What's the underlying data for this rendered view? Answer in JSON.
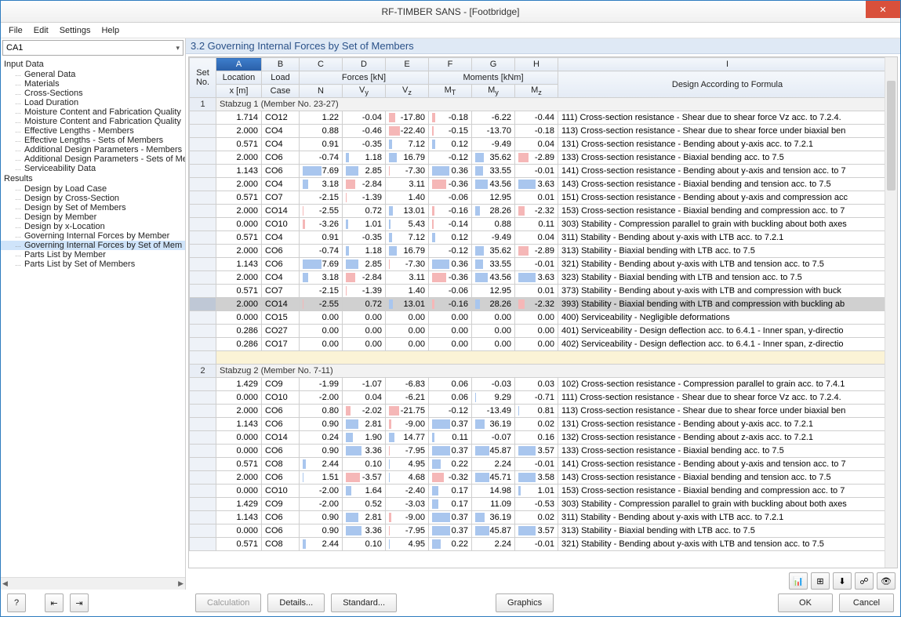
{
  "window": {
    "title": "RF-TIMBER SANS - [Footbridge]"
  },
  "menu": {
    "file": "File",
    "edit": "Edit",
    "settings": "Settings",
    "help": "Help"
  },
  "combo": {
    "value": "CA1"
  },
  "tree": {
    "input_label": "Input Data",
    "input": [
      "General Data",
      "Materials",
      "Cross-Sections",
      "Load Duration",
      "Moisture Content and Fabrication Quality",
      "Moisture Content and Fabrication Quality",
      "Effective Lengths - Members",
      "Effective Lengths - Sets of Members",
      "Additional Design Parameters - Members",
      "Additional Design Parameters - Sets of Me",
      "Serviceability Data"
    ],
    "results_label": "Results",
    "results": [
      "Design by Load Case",
      "Design by Cross-Section",
      "Design by Set of Members",
      "Design by Member",
      "Design by x-Location",
      "Governing Internal Forces by Member",
      "Governing Internal Forces by Set of Mem",
      "Parts List by Member",
      "Parts List by Set of Members"
    ],
    "selected_result_index": 6
  },
  "heading": "3.2  Governing Internal Forces by Set of Members",
  "columns": {
    "letters": [
      "A",
      "B",
      "C",
      "D",
      "E",
      "F",
      "G",
      "H",
      "I"
    ],
    "set": "Set\nNo.",
    "loc": "Location\nx [m]",
    "lc": "Load\nCase",
    "forces": "Forces [kN]",
    "moments": "Moments [kNm]",
    "n": "N",
    "vy": "Vy",
    "vz": "Vz",
    "mt": "MT",
    "my": "My",
    "mz": "Mz",
    "desc": "Design According to Formula"
  },
  "groups": [
    {
      "no": "1",
      "title": "Stabzug 1 (Member No. 23-27)",
      "rows": [
        {
          "x": "1.714",
          "lc": "CO12",
          "N": "1.22",
          "Vy": "-0.04",
          "Vz": "-17.80",
          "MT": "-0.18",
          "My": "-6.22",
          "Mz": "-0.44",
          "d": "111) Cross-section resistance - Shear due to shear force Vz acc. to 7.2.4."
        },
        {
          "x": "2.000",
          "lc": "CO4",
          "N": "0.88",
          "Vy": "-0.46",
          "Vz": "-22.40",
          "MT": "-0.15",
          "My": "-13.70",
          "Mz": "-0.18",
          "d": "113) Cross-section resistance - Shear due to shear force under biaxial ben"
        },
        {
          "x": "0.571",
          "lc": "CO4",
          "N": "0.91",
          "Vy": "-0.35",
          "Vz": "7.12",
          "MT": "0.12",
          "My": "-9.49",
          "Mz": "0.04",
          "d": "131) Cross-section resistance - Bending about y-axis acc. to 7.2.1"
        },
        {
          "x": "2.000",
          "lc": "CO6",
          "N": "-0.74",
          "Vy": "1.18",
          "Vz": "16.79",
          "MT": "-0.12",
          "My": "35.62",
          "Mz": "-2.89",
          "d": "133) Cross-section resistance - Biaxial bending acc. to 7.5"
        },
        {
          "x": "1.143",
          "lc": "CO6",
          "N": "7.69",
          "Vy": "2.85",
          "Vz": "-7.30",
          "MT": "0.36",
          "My": "33.55",
          "Mz": "-0.01",
          "d": "141) Cross-section resistance - Bending about y-axis and tension acc. to 7"
        },
        {
          "x": "2.000",
          "lc": "CO4",
          "N": "3.18",
          "Vy": "-2.84",
          "Vz": "3.11",
          "MT": "-0.36",
          "My": "43.56",
          "Mz": "3.63",
          "d": "143) Cross-section resistance - Biaxial bending and tension acc. to 7.5"
        },
        {
          "x": "0.571",
          "lc": "CO7",
          "N": "-2.15",
          "Vy": "-1.39",
          "Vz": "1.40",
          "MT": "-0.06",
          "My": "12.95",
          "Mz": "0.01",
          "d": "151) Cross-section resistance - Bending about y-axis and compression acc"
        },
        {
          "x": "2.000",
          "lc": "CO14",
          "N": "-2.55",
          "Vy": "0.72",
          "Vz": "13.01",
          "MT": "-0.16",
          "My": "28.26",
          "Mz": "-2.32",
          "d": "153) Cross-section resistance - Biaxial bending and compression acc. to 7"
        },
        {
          "x": "0.000",
          "lc": "CO10",
          "N": "-3.26",
          "Vy": "1.01",
          "Vz": "5.43",
          "MT": "-0.14",
          "My": "0.88",
          "Mz": "0.11",
          "d": "303) Stability - Compression parallel to grain with buckling about both axes"
        },
        {
          "x": "0.571",
          "lc": "CO4",
          "N": "0.91",
          "Vy": "-0.35",
          "Vz": "7.12",
          "MT": "0.12",
          "My": "-9.49",
          "Mz": "0.04",
          "d": "311) Stability - Bending about y-axis with LTB acc. to 7.2.1"
        },
        {
          "x": "2.000",
          "lc": "CO6",
          "N": "-0.74",
          "Vy": "1.18",
          "Vz": "16.79",
          "MT": "-0.12",
          "My": "35.62",
          "Mz": "-2.89",
          "d": "313) Stability - Biaxial bending with LTB acc. to 7.5"
        },
        {
          "x": "1.143",
          "lc": "CO6",
          "N": "7.69",
          "Vy": "2.85",
          "Vz": "-7.30",
          "MT": "0.36",
          "My": "33.55",
          "Mz": "-0.01",
          "d": "321) Stability - Bending about y-axis with LTB and tension acc. to 7.5"
        },
        {
          "x": "2.000",
          "lc": "CO4",
          "N": "3.18",
          "Vy": "-2.84",
          "Vz": "3.11",
          "MT": "-0.36",
          "My": "43.56",
          "Mz": "3.63",
          "d": "323) Stability - Biaxial bending with LTB and tension acc. to 7.5"
        },
        {
          "x": "0.571",
          "lc": "CO7",
          "N": "-2.15",
          "Vy": "-1.39",
          "Vz": "1.40",
          "MT": "-0.06",
          "My": "12.95",
          "Mz": "0.01",
          "d": "373) Stability - Bending about y-axis with LTB and compression with buck"
        },
        {
          "x": "2.000",
          "lc": "CO14",
          "N": "-2.55",
          "Vy": "0.72",
          "Vz": "13.01",
          "MT": "-0.16",
          "My": "28.26",
          "Mz": "-2.32",
          "d": "393) Stability - Biaxial bending with LTB and compression with buckling ab",
          "sel": true
        },
        {
          "x": "0.000",
          "lc": "CO15",
          "N": "0.00",
          "Vy": "0.00",
          "Vz": "0.00",
          "MT": "0.00",
          "My": "0.00",
          "Mz": "0.00",
          "d": "400) Serviceability - Negligible deformations"
        },
        {
          "x": "0.286",
          "lc": "CO27",
          "N": "0.00",
          "Vy": "0.00",
          "Vz": "0.00",
          "MT": "0.00",
          "My": "0.00",
          "Mz": "0.00",
          "d": "401) Serviceability - Design deflection acc. to 6.4.1 - Inner span, y-directio"
        },
        {
          "x": "0.286",
          "lc": "CO17",
          "N": "0.00",
          "Vy": "0.00",
          "Vz": "0.00",
          "MT": "0.00",
          "My": "0.00",
          "Mz": "0.00",
          "d": "402) Serviceability - Design deflection acc. to 6.4.1 - Inner span, z-directio"
        }
      ]
    },
    {
      "no": "2",
      "title": "Stabzug 2 (Member No. 7-11)",
      "rows": [
        {
          "x": "1.429",
          "lc": "CO9",
          "N": "-1.99",
          "Vy": "-1.07",
          "Vz": "-6.83",
          "MT": "0.06",
          "My": "-0.03",
          "Mz": "0.03",
          "d": "102) Cross-section resistance - Compression parallel to grain acc. to 7.4.1"
        },
        {
          "x": "0.000",
          "lc": "CO10",
          "N": "-2.00",
          "Vy": "0.04",
          "Vz": "-6.21",
          "MT": "0.06",
          "My": "9.29",
          "Mz": "-0.71",
          "d": "111) Cross-section resistance - Shear due to shear force Vz acc. to 7.2.4."
        },
        {
          "x": "2.000",
          "lc": "CO6",
          "N": "0.80",
          "Vy": "-2.02",
          "Vz": "-21.75",
          "MT": "-0.12",
          "My": "-13.49",
          "Mz": "0.81",
          "d": "113) Cross-section resistance - Shear due to shear force under biaxial ben"
        },
        {
          "x": "1.143",
          "lc": "CO6",
          "N": "0.90",
          "Vy": "2.81",
          "Vz": "-9.00",
          "MT": "0.37",
          "My": "36.19",
          "Mz": "0.02",
          "d": "131) Cross-section resistance - Bending about y-axis acc. to 7.2.1"
        },
        {
          "x": "0.000",
          "lc": "CO14",
          "N": "0.24",
          "Vy": "1.90",
          "Vz": "14.77",
          "MT": "0.11",
          "My": "-0.07",
          "Mz": "0.16",
          "d": "132) Cross-section resistance - Bending about z-axis acc. to 7.2.1"
        },
        {
          "x": "0.000",
          "lc": "CO6",
          "N": "0.90",
          "Vy": "3.36",
          "Vz": "-7.95",
          "MT": "0.37",
          "My": "45.87",
          "Mz": "3.57",
          "d": "133) Cross-section resistance - Biaxial bending acc. to 7.5"
        },
        {
          "x": "0.571",
          "lc": "CO8",
          "N": "2.44",
          "Vy": "0.10",
          "Vz": "4.95",
          "MT": "0.22",
          "My": "2.24",
          "Mz": "-0.01",
          "d": "141) Cross-section resistance - Bending about y-axis and tension acc. to 7"
        },
        {
          "x": "2.000",
          "lc": "CO6",
          "N": "1.51",
          "Vy": "-3.57",
          "Vz": "4.68",
          "MT": "-0.32",
          "My": "45.71",
          "Mz": "3.58",
          "d": "143) Cross-section resistance - Biaxial bending and tension acc. to 7.5"
        },
        {
          "x": "0.000",
          "lc": "CO10",
          "N": "-2.00",
          "Vy": "1.64",
          "Vz": "-2.40",
          "MT": "0.17",
          "My": "14.98",
          "Mz": "1.01",
          "d": "153) Cross-section resistance - Biaxial bending and compression acc. to 7"
        },
        {
          "x": "1.429",
          "lc": "CO9",
          "N": "-2.00",
          "Vy": "0.52",
          "Vz": "-3.03",
          "MT": "0.17",
          "My": "11.09",
          "Mz": "-0.53",
          "d": "303) Stability - Compression parallel to grain with buckling about both axes"
        },
        {
          "x": "1.143",
          "lc": "CO6",
          "N": "0.90",
          "Vy": "2.81",
          "Vz": "-9.00",
          "MT": "0.37",
          "My": "36.19",
          "Mz": "0.02",
          "d": "311) Stability - Bending about y-axis with LTB acc. to 7.2.1"
        },
        {
          "x": "0.000",
          "lc": "CO6",
          "N": "0.90",
          "Vy": "3.36",
          "Vz": "-7.95",
          "MT": "0.37",
          "My": "45.87",
          "Mz": "3.57",
          "d": "313) Stability - Biaxial bending with LTB acc. to 7.5"
        },
        {
          "x": "0.571",
          "lc": "CO8",
          "N": "2.44",
          "Vy": "0.10",
          "Vz": "4.95",
          "MT": "0.22",
          "My": "2.24",
          "Mz": "-0.01",
          "d": "321) Stability - Bending about y-axis with LTB and tension acc. to 7.5"
        }
      ]
    }
  ],
  "toolbar_icons": [
    "chart-icon",
    "table-icon",
    "excel-icon",
    "filter-icon",
    "eye-icon"
  ],
  "footer": {
    "help": "?",
    "nav1": "↹",
    "nav2": "↹",
    "calculation": "Calculation",
    "details": "Details...",
    "standard": "Standard...",
    "graphics": "Graphics",
    "ok": "OK",
    "cancel": "Cancel"
  },
  "ranges": {
    "N": 8,
    "Vy": 4,
    "Vz": 23,
    "MT": 0.4,
    "My": 46,
    "Mz": 4
  }
}
